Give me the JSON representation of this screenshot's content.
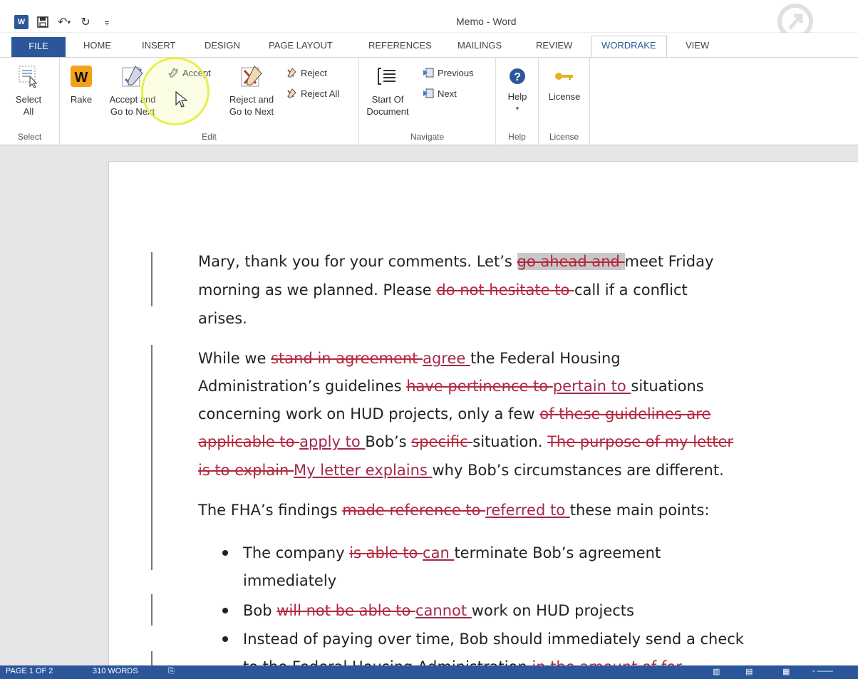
{
  "window": {
    "title": "Memo - Word"
  },
  "tabs": {
    "file": "FILE",
    "home": "HOME",
    "insert": "INSERT",
    "design": "DESIGN",
    "page_layout": "PAGE LAYOUT",
    "references": "REFERENCES",
    "mailings": "MAILINGS",
    "review": "REVIEW",
    "wordrake": "WORDRAKE",
    "view": "VIEW"
  },
  "ribbon": {
    "select_all_line1": "Select",
    "select_all_line2": "All",
    "select_group": "Select",
    "rake": "Rake",
    "accept_and_line1": "Accept and",
    "accept_and_line2": "Go to Next",
    "accept": "Accept",
    "reject_and_line1": "Reject and",
    "reject_and_line2": "Go to Next",
    "reject": "Reject",
    "reject_all": "Reject All",
    "edit_group": "Edit",
    "start_of_line1": "Start Of",
    "start_of_line2": "Document",
    "previous": "Previous",
    "next": "Next",
    "navigate_group": "Navigate",
    "help": "Help",
    "help_group": "Help",
    "license": "License",
    "license_group": "License"
  },
  "doc": {
    "l1a": "Mary, thank you for your comments.  Let’s ",
    "l1del": "go ahead and ",
    "l1b": "meet Friday",
    "l2a": "morning as we planned.  Please ",
    "l2del": "do not hesitate to ",
    "l2b": "call if a conflict",
    "l3": "arises.",
    "l4a": "While we ",
    "l4del": "stand in agreement ",
    "l4ins": "agree ",
    "l4b": "the Federal Housing",
    "l5a": "Administration’s guidelines ",
    "l5del": "have pertinence to ",
    "l5ins": "pertain to ",
    "l5b": "situations",
    "l6a": "concerning work on HUD projects, only a few ",
    "l6del": "of these guidelines are",
    "l7del1": "applicable to ",
    "l7ins": "apply to ",
    "l7a": "Bob’s ",
    "l7del2": "specific ",
    "l7b": "situation.  ",
    "l7del3": "The purpose of my letter",
    "l8del": "is to explain ",
    "l8ins": "My letter explains ",
    "l8b": "why Bob’s circumstances are different.",
    "l9a": "The FHA’s findings ",
    "l9del": "made reference to ",
    "l9ins": "referred to ",
    "l9b": "these main points:",
    "b1a": "The company ",
    "b1del": "is able to ",
    "b1ins": "can ",
    "b1b": "terminate Bob’s agreement",
    "b1c": "immediately",
    "b2a": "Bob ",
    "b2del": "will not be able to ",
    "b2ins": "cannot ",
    "b2b": "work on HUD projects",
    "b3a": "Instead of paying over time, Bob should immediately send a check",
    "b3b": "to the Federal Housing Administration ",
    "b3del": "in the amount of for"
  },
  "status": {
    "page": "PAGE 1 OF 2",
    "words": "310 WORDS"
  },
  "colors": {
    "brand": "#2b579a",
    "deleted": "#b4283f",
    "inserted": "#a2294a",
    "highlight_circle": "#e9ef4a"
  }
}
